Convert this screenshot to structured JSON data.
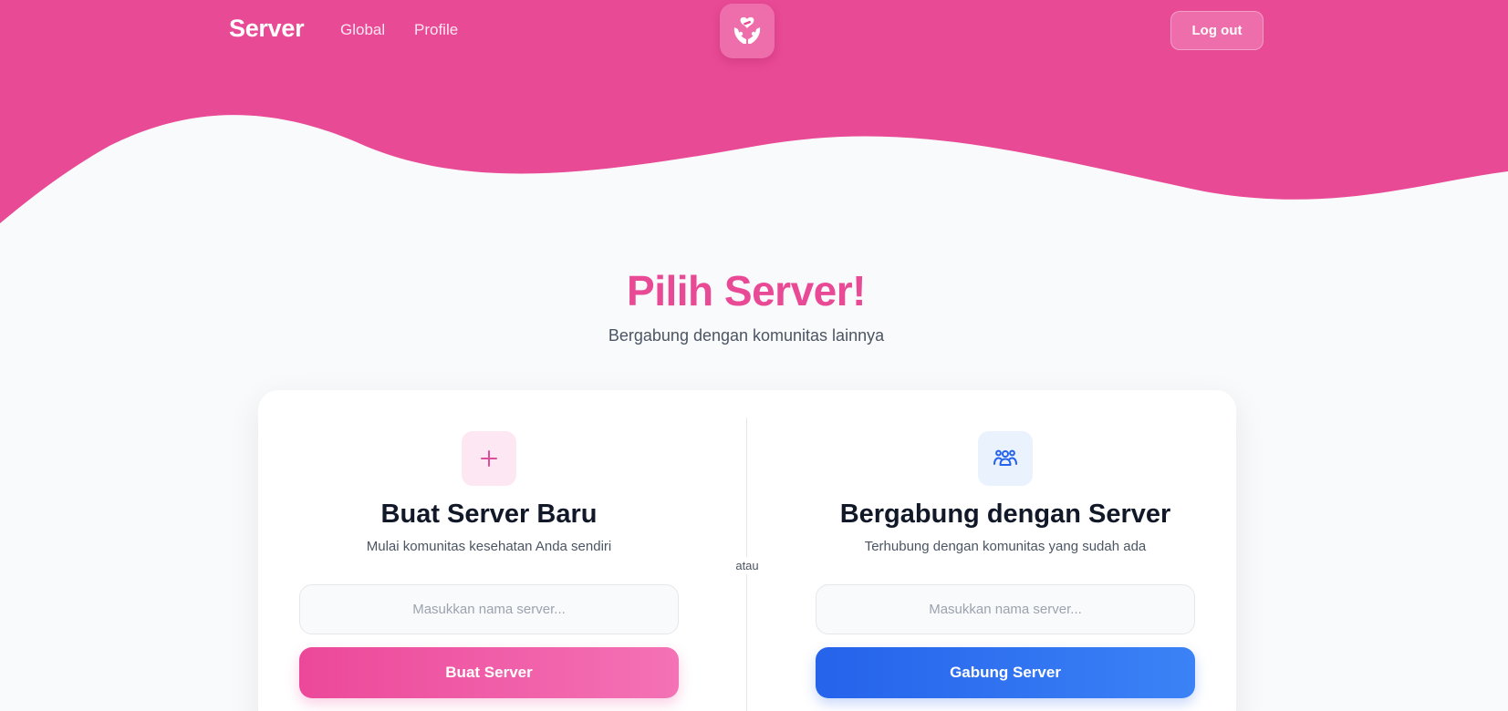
{
  "colors": {
    "header_pink": "#e94a96",
    "page_background": "#f9fafb",
    "title_pink": "#e94a96",
    "create_button": "#ec4899",
    "join_button": "#2563eb"
  },
  "navbar": {
    "brand": "Server",
    "links": [
      "Global",
      "Profile"
    ],
    "logo_icon": "caring-hands-icon",
    "logout_label": "Log out"
  },
  "hero": {
    "title": "Pilih Server!",
    "subtitle": "Bergabung dengan komunitas lainnya"
  },
  "card": {
    "divider_label": "atau",
    "create": {
      "icon": "plus-icon",
      "title": "Buat Server Baru",
      "description": "Mulai komunitas kesehatan Anda sendiri",
      "input_placeholder": "Masukkan nama server...",
      "input_value": "",
      "button_label": "Buat Server"
    },
    "join": {
      "icon": "users-group-icon",
      "title": "Bergabung dengan Server",
      "description": "Terhubung dengan komunitas yang sudah ada",
      "input_placeholder": "Masukkan nama server...",
      "input_value": "",
      "button_label": "Gabung Server"
    }
  }
}
